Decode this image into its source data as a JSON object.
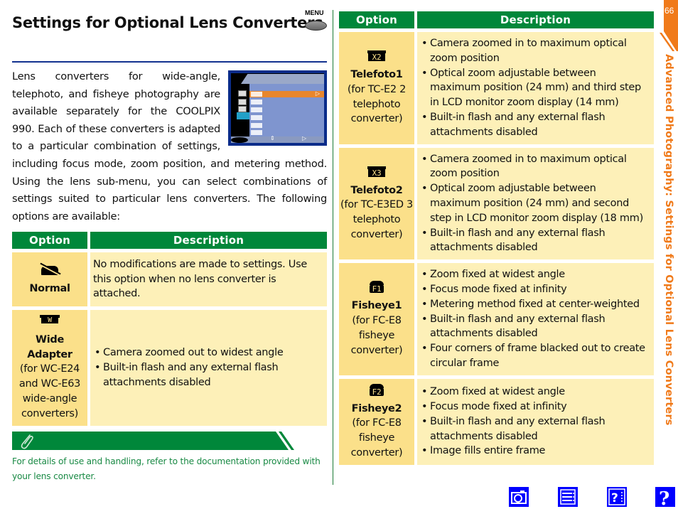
{
  "page": {
    "title": "Settings for Optional Lens Converters",
    "menu_button_label": "MENU",
    "page_number": "66",
    "section_tab": "Advanced Photography: Settings for Optional Lens Converters"
  },
  "intro": {
    "text": "Lens converters for wide-angle, telephoto, and fisheye photography are available separately for the COOLPIX 990.  Each of these converters is adapted to a particular combination of settings, including focus mode, zoom position, and metering method.  Using the lens sub-menu, you can select combinations of settings suited to particular lens converters. The following options are available:"
  },
  "lcd_menu": {
    "items": [
      "normal-icon",
      "wide-icon",
      "x2-icon",
      "x3-icon",
      "f1-icon",
      "f2-icon"
    ],
    "selected_index": 0
  },
  "table_headers": {
    "option": "Option",
    "description": "Description"
  },
  "options": [
    {
      "icon": "normal-lens-icon",
      "icon_text": "",
      "name": "Normal",
      "sub": "",
      "description": "No modifications are made to settings.  Use this option when no lens converter is attached.",
      "bullets": []
    },
    {
      "icon": "wide-lens-icon",
      "icon_text": "W",
      "name": "Wide Adapter",
      "sub": "(for WC-E24 and WC-E63 wide-angle converters)",
      "description": "",
      "bullets": [
        "Camera zoomed out to widest angle",
        "Built-in flash and any external flash attachments disabled"
      ]
    },
    {
      "icon": "tele-x2-icon",
      "icon_text": "X2",
      "name": "Telefoto1",
      "sub": "(for TC-E2 2 telephoto converter)",
      "description": "",
      "bullets": [
        "Camera zoomed in to maximum optical zoom position",
        "Optical zoom adjustable between maximum position (24 mm) and third step in LCD monitor zoom display (14 mm)",
        "Built-in flash and any external flash attachments disabled"
      ]
    },
    {
      "icon": "tele-x3-icon",
      "icon_text": "X3",
      "name": "Telefoto2",
      "sub": "(for TC-E3ED 3 telephoto converter)",
      "description": "",
      "bullets": [
        "Camera zoomed in to maximum optical zoom position",
        "Optical zoom adjustable between maximum position (24 mm) and second step in LCD monitor zoom display (18 mm)",
        "Built-in flash and any external flash attachments disabled"
      ]
    },
    {
      "icon": "fisheye-f1-icon",
      "icon_text": "F1",
      "name": "Fisheye1",
      "sub": "(for FC-E8 fisheye converter)",
      "description": "",
      "bullets": [
        "Zoom fixed at widest angle",
        "Focus mode fixed at infinity",
        "Metering method fixed at center-weighted",
        "Built-in flash and any external flash attachments disabled",
        "Four corners of frame blacked out to create circular frame"
      ]
    },
    {
      "icon": "fisheye-f2-icon",
      "icon_text": "F2",
      "name": "Fisheye2",
      "sub": "(for FC-E8 fisheye converter)",
      "description": "",
      "bullets": [
        "Zoom fixed at widest angle",
        "Focus mode fixed at infinity",
        "Built-in flash and any external flash attachments disabled",
        "Image fills entire frame"
      ]
    }
  ],
  "note": {
    "icon": "paperclip-icon",
    "text": "For details of use and handling, refer to the documentation provided with your lens converter."
  },
  "nav_buttons": [
    {
      "name": "camera-icon",
      "label": "Camera"
    },
    {
      "name": "contents-icon",
      "label": "Contents"
    },
    {
      "name": "index-help-icon",
      "label": "Index"
    },
    {
      "name": "help-icon",
      "label": "Help"
    }
  ],
  "colors": {
    "header_green": "#00873a",
    "option_cell": "#fbe08a",
    "description_cell": "#fdf0b8",
    "title_rule": "#12318f",
    "tab_orange": "#f07a1a",
    "note_text": "#1a8a45",
    "nav_blue": "#0000ff"
  }
}
